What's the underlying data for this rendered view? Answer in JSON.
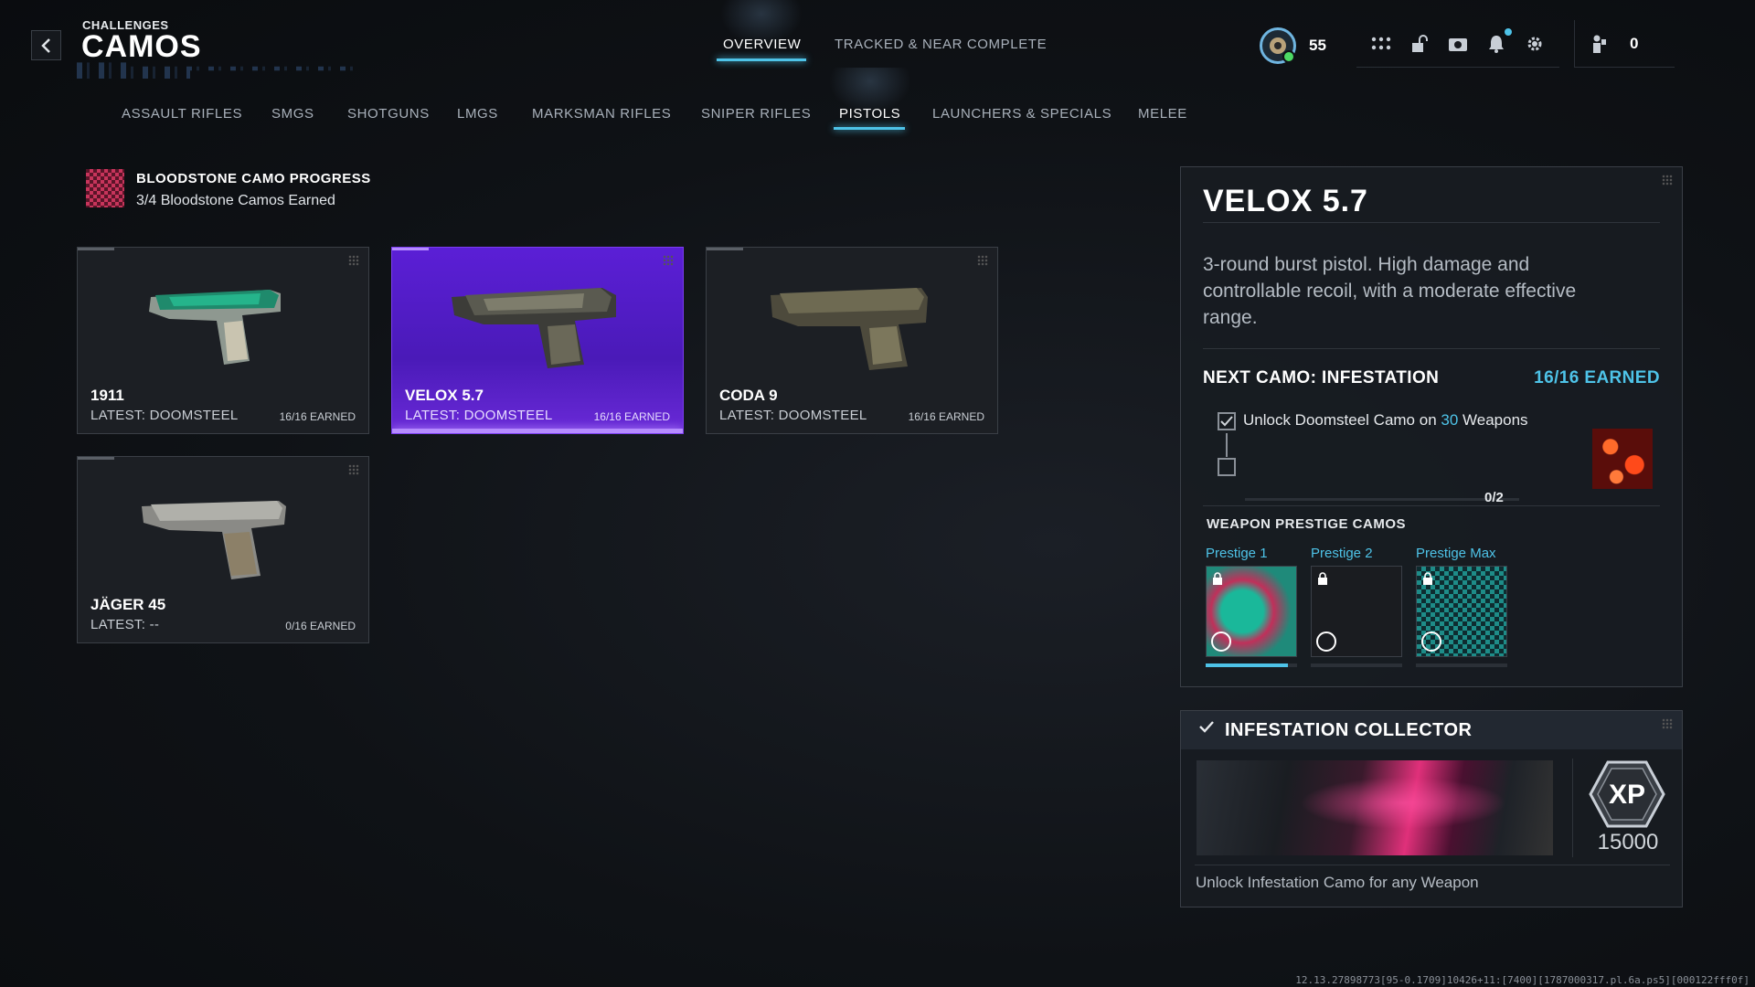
{
  "header": {
    "kicker": "CHALLENGES",
    "title": "CAMOS",
    "tabs": [
      {
        "label": "OVERVIEW",
        "active": true
      },
      {
        "label": "TRACKED & NEAR COMPLETE",
        "active": false
      }
    ],
    "level": "55",
    "currency": "0"
  },
  "categories": [
    {
      "label": "ASSAULT RIFLES",
      "active": false
    },
    {
      "label": "SMGS",
      "active": false
    },
    {
      "label": "SHOTGUNS",
      "active": false
    },
    {
      "label": "LMGS",
      "active": false
    },
    {
      "label": "MARKSMAN RIFLES",
      "active": false
    },
    {
      "label": "SNIPER RIFLES",
      "active": false
    },
    {
      "label": "PISTOLS",
      "active": true
    },
    {
      "label": "LAUNCHERS & SPECIALS",
      "active": false
    },
    {
      "label": "MELEE",
      "active": false
    }
  ],
  "bloodstone": {
    "title": "BLOODSTONE CAMO PROGRESS",
    "subtitle": "3/4 Bloodstone Camos Earned"
  },
  "weapons": [
    {
      "name": "1911",
      "latest": "LATEST: DOOMSTEEL",
      "earned": "16/16 EARNED",
      "selected": false
    },
    {
      "name": "VELOX 5.7",
      "latest": "LATEST: DOOMSTEEL",
      "earned": "16/16 EARNED",
      "selected": true
    },
    {
      "name": "CODA 9",
      "latest": "LATEST: DOOMSTEEL",
      "earned": "16/16 EARNED",
      "selected": false
    },
    {
      "name": "JÄGER 45",
      "latest": "LATEST: --",
      "earned": "0/16 EARNED",
      "selected": false
    }
  ],
  "detail": {
    "title": "VELOX 5.7",
    "description": "3-round burst pistol. High damage and controllable recoil, with a moderate effective range.",
    "next_camo_label": "NEXT CAMO: INFESTATION",
    "next_camo_earned": "16/16 EARNED",
    "challenge_prefix": "Unlock Doomsteel Camo on ",
    "challenge_count": "30",
    "challenge_suffix": " Weapons",
    "progress_label": "0/2",
    "prestige_heading": "WEAPON PRESTIGE CAMOS",
    "prestige": [
      {
        "label": "Prestige 1",
        "progress": 0.9
      },
      {
        "label": "Prestige 2",
        "progress": 0
      },
      {
        "label": "Prestige Max",
        "progress": 0
      }
    ]
  },
  "collector": {
    "title": "INFESTATION COLLECTOR",
    "xp_label": "XP",
    "xp_value": "15000",
    "description": "Unlock Infestation Camo for any Weapon"
  },
  "version": "12.13.27898773[95-0.1709]10426+11:[7400][1787000317.pl.6a.ps5][000122fff0f]",
  "colors": {
    "accent": "#4ec3e8",
    "selected_card": "#5b1fd6"
  }
}
